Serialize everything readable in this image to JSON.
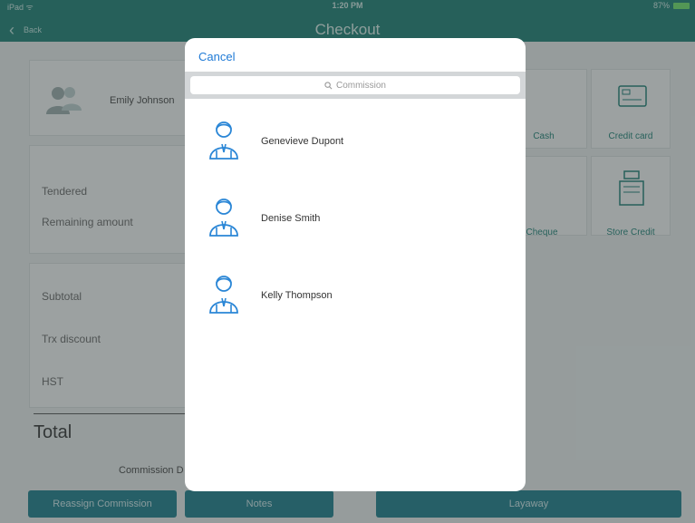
{
  "status_bar": {
    "carrier": "iPad ᯤ",
    "time": "1:20 PM",
    "battery": "87%"
  },
  "nav": {
    "back_label": "Back",
    "title": "Checkout"
  },
  "customer": {
    "name": "Emily Johnson"
  },
  "summary": {
    "tendered": "Tendered",
    "remaining": "Remaining amount",
    "subtotal": "Subtotal",
    "trx_discount": "Trx discount",
    "hst": "HST",
    "total": "Total",
    "commission": "Commission D"
  },
  "payment_methods": [
    "Cash",
    "Credit card",
    "Cheque",
    "Store Credit"
  ],
  "bottom_buttons": {
    "reassign": "Reassign Commission",
    "notes": "Notes",
    "layaway": "Layaway"
  },
  "modal": {
    "cancel_label": "Cancel",
    "search_placeholder": "Commission",
    "people": [
      {
        "name": "Genevieve Dupont"
      },
      {
        "name": "Denise Smith"
      },
      {
        "name": "Kelly Thompson"
      }
    ]
  },
  "colors": {
    "accent": "#1c7f74",
    "link": "#1f7ad6",
    "person_icon": "#2a86d6"
  }
}
